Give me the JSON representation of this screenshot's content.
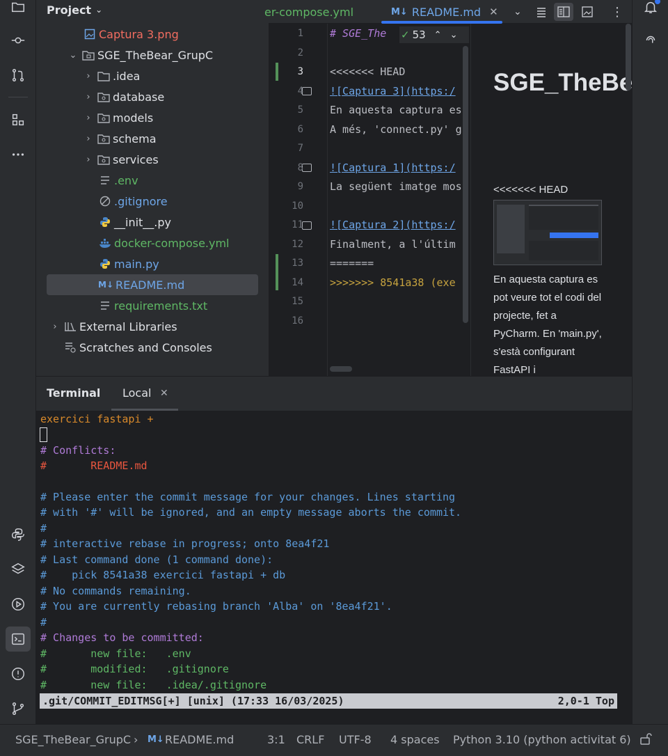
{
  "project_panel": {
    "title": "Project",
    "items": [
      {
        "label": "Captura 3.png",
        "kind": "image"
      },
      {
        "label": "SGE_TheBear_GrupC",
        "kind": "module"
      },
      {
        "label": ".idea",
        "kind": "folder"
      },
      {
        "label": "database",
        "kind": "folder"
      },
      {
        "label": "models",
        "kind": "folder"
      },
      {
        "label": "schema",
        "kind": "folder"
      },
      {
        "label": "services",
        "kind": "folder"
      },
      {
        "label": ".env",
        "kind": "text"
      },
      {
        "label": ".gitignore",
        "kind": "ignore"
      },
      {
        "label": "__init__.py",
        "kind": "python"
      },
      {
        "label": "docker-compose.yml",
        "kind": "docker"
      },
      {
        "label": "main.py",
        "kind": "python"
      },
      {
        "label": "README.md",
        "kind": "markdown"
      },
      {
        "label": "requirements.txt",
        "kind": "text"
      },
      {
        "label": "External Libraries",
        "kind": "library"
      },
      {
        "label": "Scratches and Consoles",
        "kind": "scratch"
      }
    ]
  },
  "editor_tabs": {
    "prev_tab": "er-compose.yml",
    "active_tab_icon": "M↓",
    "active_tab": "README.md"
  },
  "editor": {
    "inspection_count": "53",
    "line_numbers": [
      "1",
      "2",
      "3",
      "4",
      "5",
      "6",
      "7",
      "8",
      "9",
      "10",
      "11",
      "12",
      "13",
      "14",
      "15",
      "16"
    ],
    "lines": [
      "# SGE_The",
      "",
      "<<<<<<< HEAD",
      "![Captura 3](https:/",
      "En aquesta captura es",
      "A més, 'connect.py' g",
      "",
      "![Captura 1](https:/",
      "La següent imatge mos",
      "",
      "![Captura 2](https:/",
      "Finalment, a l'últim",
      "=======",
      ">>>>>>> 8541a38 (exe",
      "",
      ""
    ]
  },
  "preview": {
    "title": "SGE_TheBear_GrupC",
    "head_marker": "<<<<<<< HEAD",
    "text": "En aquesta captura es pot veure tot el codi del projecte, fet a PyCharm. En 'main.py', s'està configurant FastAPI i"
  },
  "terminal": {
    "title": "Terminal",
    "tab": "Local",
    "lines": [
      "exercici fastapi +",
      "",
      "# Conflicts:",
      "#       README.md",
      "",
      "# Please enter the commit message for your changes. Lines starting",
      "# with '#' will be ignored, and an empty message aborts the commit.",
      "#",
      "# interactive rebase in progress; onto 8ea4f21",
      "# Last command done (1 command done):",
      "#    pick 8541a38 exercici fastapi + db",
      "# No commands remaining.",
      "# You are currently rebasing branch 'Alba' on '8ea4f21'.",
      "#",
      "# Changes to be committed:",
      "#       new file:   .env",
      "#       modified:   .gitignore",
      "#       new file:   .idea/.gitignore"
    ],
    "vim_status_left": ".git/COMMIT_EDITMSG[+] [unix] (17:33 16/03/2025)",
    "vim_status_right": "2,0-1 Top"
  },
  "status_bar": {
    "project": "SGE_TheBear_GrupC",
    "file_icon": "M↓",
    "file": "README.md",
    "position": "3:1",
    "line_ending": "CRLF",
    "encoding": "UTF-8",
    "indent": "4 spaces",
    "interpreter": "Python 3.10 (python activitat 6)"
  },
  "colors": {
    "accent": "#3574f0",
    "vcs_added": "#5fb865",
    "conflict": "#e8563f"
  }
}
